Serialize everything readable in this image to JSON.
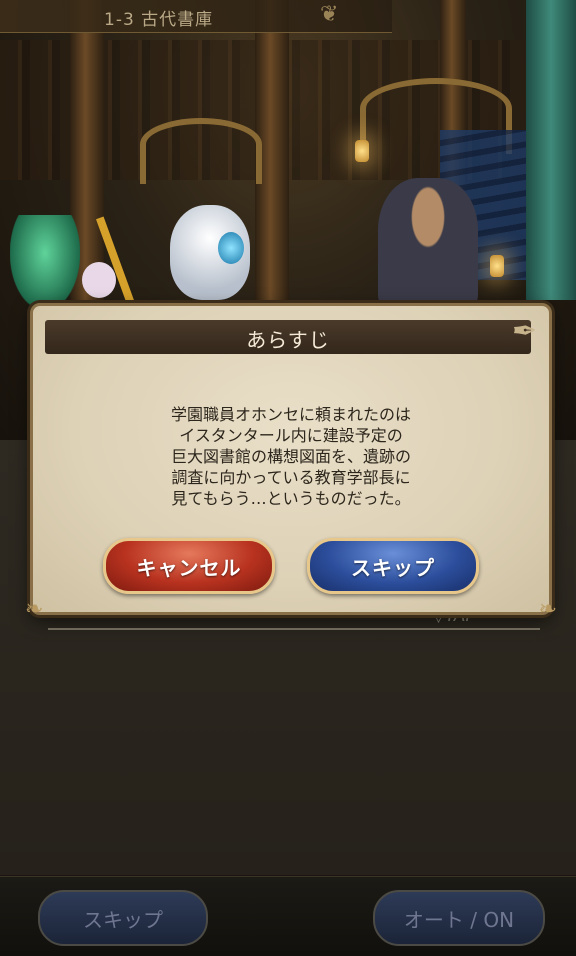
{
  "stage": {
    "title": "1-3 古代書庫"
  },
  "dialog": {
    "title": "あらすじ",
    "synopsis": "学園職員オホンセに頼まれたのは\nイスタンタール内に建設予定の\n巨大図書館の構想図面を、遺跡の\n調査に向かっている教育学部長に\n見てもらう…というものだった。",
    "cancel_label": "キャンセル",
    "skip_label": "スキップ"
  },
  "dialogue_box": {
    "tap_label": "▽TAP"
  },
  "footer": {
    "skip_label": "スキップ",
    "auto_label": "オート / ON"
  },
  "icons": {
    "quill": "quill-icon",
    "corner": "ornament-corner-icon"
  }
}
